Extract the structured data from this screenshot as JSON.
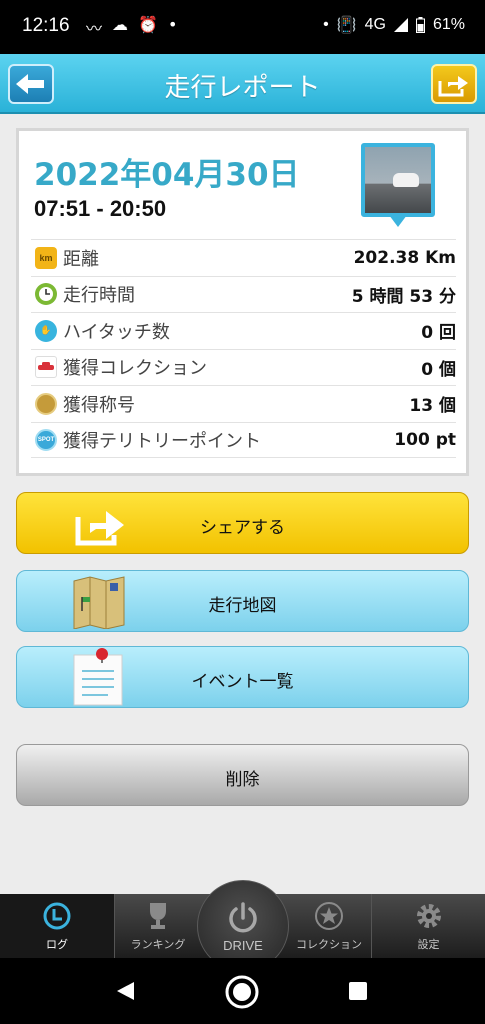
{
  "status_bar": {
    "time": "12:16",
    "network": "4G",
    "battery": "61%"
  },
  "header": {
    "title": "走行レポート"
  },
  "report": {
    "date": "2022年04月30日",
    "time_range": "07:51 - 20:50",
    "rows": [
      {
        "icon": "km-icon",
        "icon_text": "km",
        "label": "距離",
        "value": "202.38 Km",
        "color": "#f2b417"
      },
      {
        "icon": "clock-icon",
        "icon_text": "",
        "label": "走行時間",
        "value": "5 時間 53 分",
        "color": "#7cb934"
      },
      {
        "icon": "high-touch-icon",
        "icon_text": "",
        "label": "ハイタッチ数",
        "value": "0 回",
        "color": "#38b4de"
      },
      {
        "icon": "car-collection-icon",
        "icon_text": "",
        "label": "獲得コレクション",
        "value": "0 個",
        "color": "#d9323a"
      },
      {
        "icon": "title-medal-icon",
        "icon_text": "",
        "label": "獲得称号",
        "value": "13 個",
        "color": "#c59b3a"
      },
      {
        "icon": "spot-icon",
        "icon_text": "SPOT",
        "label": "獲得テリトリーポイント",
        "value": "100 pt",
        "color": "#3aa9d9"
      }
    ]
  },
  "buttons": {
    "share": "シェアする",
    "map": "走行地図",
    "events": "イベント一覧",
    "delete": "削除"
  },
  "bottom_nav": {
    "log": "ログ",
    "ranking": "ランキング",
    "drive": "DRIVE",
    "collection": "コレクション",
    "settings": "設定"
  },
  "colors": {
    "accent": "#37a9c8",
    "share": "#f2c200",
    "primary_light": "#7cd1ec"
  }
}
